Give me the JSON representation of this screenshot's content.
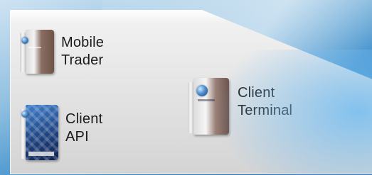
{
  "products": [
    {
      "line1": "Mobile",
      "line2": "Trader",
      "icon": "software-box-icon"
    },
    {
      "line1": "Client",
      "line2": "API",
      "icon": "software-box-icon"
    },
    {
      "line1": "Client",
      "line2": "Terminal",
      "icon": "software-box-icon"
    }
  ],
  "colors": {
    "panel": "#e6e6e6",
    "background_blue": "#2f86c8",
    "text": "#1a1a1a"
  }
}
